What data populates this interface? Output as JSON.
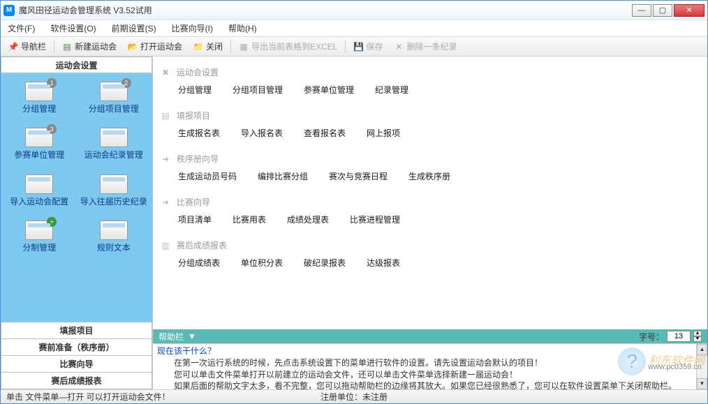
{
  "window": {
    "title": "魔风田径运动会管理系统 V3.52试用",
    "icon_letter": "M"
  },
  "menubar": {
    "file": "文件(F)",
    "software_settings": "软件设置(O)",
    "pre_settings": "前期设置(S)",
    "competition_wizard": "比赛向导(I)",
    "help": "帮助(H)"
  },
  "toolbar": {
    "nav": "导航栏",
    "new_games": "新建运动会",
    "open_games": "打开运动会",
    "close": "关闭",
    "export_excel": "导出当前表格到EXCEL",
    "save": "保存",
    "delete_record": "删除一条纪录"
  },
  "sidebar": {
    "header": "运动会设置",
    "items": [
      {
        "label": "分组管理",
        "badge": "1"
      },
      {
        "label": "分组项目管理",
        "badge": "2"
      },
      {
        "label": "参赛单位管理",
        "badge": "3"
      },
      {
        "label": "运动会纪录管理",
        "badge": ""
      },
      {
        "label": "导入运动会配置",
        "badge": ""
      },
      {
        "label": "导入往届历史纪录",
        "badge": ""
      },
      {
        "label": "分制管理",
        "badge": "+"
      },
      {
        "label": "规则文本",
        "badge": ""
      }
    ],
    "bottom": [
      "填报项目",
      "赛前准备（秩序册）",
      "比赛向导",
      "赛后成绩报表"
    ]
  },
  "sections": [
    {
      "title": "运动会设置",
      "icon": "tools",
      "links": [
        "分组管理",
        "分组项目管理",
        "参赛单位管理",
        "纪录管理"
      ]
    },
    {
      "title": "填报项目",
      "icon": "form",
      "links": [
        "生成报名表",
        "导入报名表",
        "查看报名表",
        "网上报项"
      ]
    },
    {
      "title": "秩序册向导",
      "icon": "arrow",
      "links": [
        "生成运动员号码",
        "编排比赛分组",
        "赛次与竞赛日程",
        "生成秩序册"
      ]
    },
    {
      "title": "比赛向导",
      "icon": "arrow",
      "links": [
        "项目清单",
        "比赛用表",
        "成绩处理表",
        "比赛进程管理"
      ]
    },
    {
      "title": "赛后成绩报表",
      "icon": "report",
      "links": [
        "分组成绩表",
        "单位积分表",
        "破纪录报表",
        "达级报表"
      ]
    }
  ],
  "helpbar": {
    "title": "帮助栏",
    "arrow": "▼",
    "font_label": "字号：",
    "font_value": "13",
    "q": "现在该干什么？",
    "line1": "在第一次运行系统的时候，先点击系统设置下的菜单进行软件的设置。请先设置运动会默认的项目！",
    "line2": "您可以单击文件菜单打开以前建立的运动会文件，还可以单击文件菜单选择新建一届运动会！",
    "line3": "如果后面的帮助文字太多，看不完整，您可以拖动帮助栏的边缘将其放大。如果您已经很熟悉了，您可以在软件设置菜单下关闭帮助栏。"
  },
  "statusbar": {
    "left": "单击 文件菜单—打开 可以打开运动会文件！",
    "mid_label": "注册单位：",
    "mid_value": "未注册"
  },
  "watermark": {
    "text": "利东软件网",
    "url": "www.pc0359.cn"
  }
}
